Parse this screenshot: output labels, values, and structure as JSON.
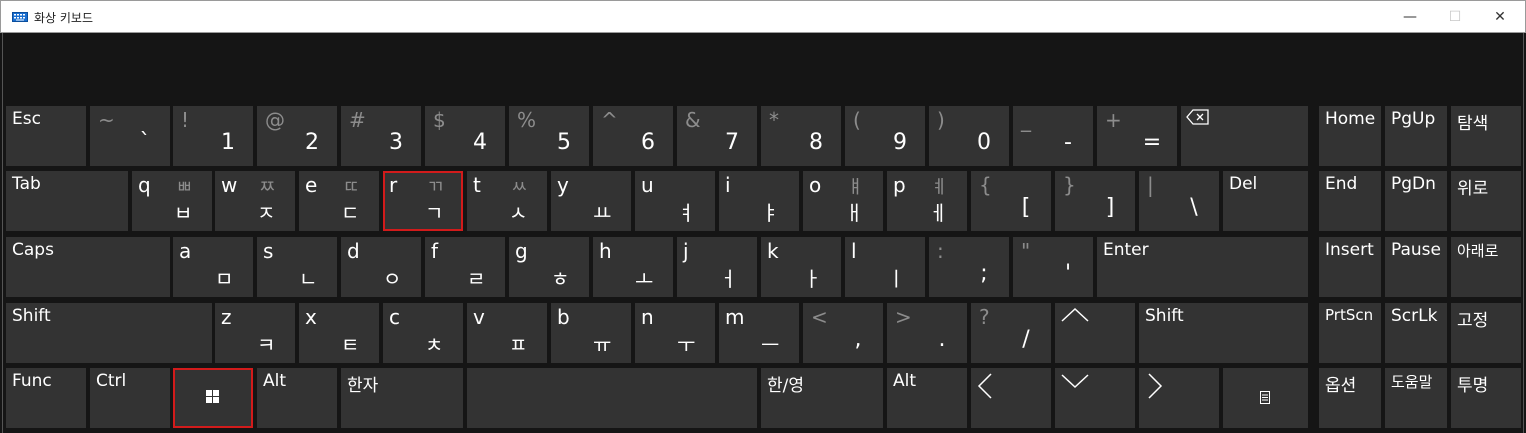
{
  "window": {
    "title": "화상 키보드",
    "minimize": "—",
    "maximize": "☐",
    "close": "✕"
  },
  "colors": {
    "key_bg": "#333333",
    "highlight": "#d21b1b",
    "panel_bg": "#151515",
    "muted_text": "#8c8c8c"
  },
  "row1": {
    "esc": "Esc",
    "k1": {
      "sh": "~",
      "base": "`"
    },
    "k2": {
      "sh": "!",
      "base": "1"
    },
    "k3": {
      "sh": "@",
      "base": "2"
    },
    "k4": {
      "sh": "#",
      "base": "3"
    },
    "k5": {
      "sh": "$",
      "base": "4"
    },
    "k6": {
      "sh": "%",
      "base": "5"
    },
    "k7": {
      "sh": "^",
      "base": "6"
    },
    "k8": {
      "sh": "&",
      "base": "7"
    },
    "k9": {
      "sh": "*",
      "base": "8"
    },
    "k10": {
      "sh": "(",
      "base": "9"
    },
    "k11": {
      "sh": ")",
      "base": "0"
    },
    "k12": {
      "sh": "_",
      "base": "-"
    },
    "k13": {
      "sh": "+",
      "base": "="
    },
    "backspace_icon": "backspace-icon"
  },
  "row2": {
    "tab": "Tab",
    "q": {
      "l": "q",
      "sh": "ㅃ",
      "h": "ㅂ"
    },
    "w": {
      "l": "w",
      "sh": "ㅉ",
      "h": "ㅈ"
    },
    "e": {
      "l": "e",
      "sh": "ㄸ",
      "h": "ㄷ"
    },
    "r": {
      "l": "r",
      "sh": "ㄲ",
      "h": "ㄱ"
    },
    "t": {
      "l": "t",
      "sh": "ㅆ",
      "h": "ㅅ"
    },
    "y": {
      "l": "y",
      "sh": "",
      "h": "ㅛ"
    },
    "u": {
      "l": "u",
      "sh": "",
      "h": "ㅕ"
    },
    "i": {
      "l": "i",
      "sh": "",
      "h": "ㅑ"
    },
    "o": {
      "l": "o",
      "sh": "ㅒ",
      "h": "ㅐ"
    },
    "p": {
      "l": "p",
      "sh": "ㅖ",
      "h": "ㅔ"
    },
    "lbracket": {
      "sh": "{",
      "base": "["
    },
    "rbracket": {
      "sh": "}",
      "base": "]"
    },
    "backslash": {
      "sh": "|",
      "base": "\\"
    },
    "del": "Del"
  },
  "row3": {
    "caps": "Caps",
    "a": {
      "l": "a",
      "h": "ㅁ"
    },
    "s": {
      "l": "s",
      "h": "ㄴ"
    },
    "d": {
      "l": "d",
      "h": "ㅇ"
    },
    "f": {
      "l": "f",
      "h": "ㄹ"
    },
    "g": {
      "l": "g",
      "h": "ㅎ"
    },
    "h": {
      "l": "h",
      "h": "ㅗ"
    },
    "j": {
      "l": "j",
      "h": "ㅓ"
    },
    "k": {
      "l": "k",
      "h": "ㅏ"
    },
    "lk": {
      "l": "l",
      "h": "ㅣ"
    },
    "semicolon": {
      "sh": ":",
      "base": ";"
    },
    "quote": {
      "sh": "\"",
      "base": "'"
    },
    "enter": "Enter"
  },
  "row4": {
    "shift_left": "Shift",
    "z": {
      "l": "z",
      "h": "ㅋ"
    },
    "x": {
      "l": "x",
      "h": "ㅌ"
    },
    "c": {
      "l": "c",
      "h": "ㅊ"
    },
    "v": {
      "l": "v",
      "h": "ㅍ"
    },
    "b": {
      "l": "b",
      "h": "ㅠ"
    },
    "n": {
      "l": "n",
      "h": "ㅜ"
    },
    "m": {
      "l": "m",
      "h": "ㅡ"
    },
    "comma": {
      "sh": "<",
      "base": ","
    },
    "period": {
      "sh": ">",
      "base": "."
    },
    "slash": {
      "sh": "?",
      "base": "/"
    },
    "up_icon": "chevron-up-icon",
    "shift_right": "Shift"
  },
  "row5": {
    "func": "Func",
    "ctrl": "Ctrl",
    "win_icon": "windows-logo-icon",
    "alt_left": "Alt",
    "hanja": "한자",
    "space": "",
    "hanyeong": "한/영",
    "alt_right": "Alt",
    "left_icon": "chevron-left-icon",
    "down_icon": "chevron-down-icon",
    "right_icon": "chevron-right-icon",
    "menu_icon": "context-menu-icon"
  },
  "nav": {
    "home": "Home",
    "pgup": "PgUp",
    "search": "탐색",
    "end": "End",
    "pgdn": "PgDn",
    "up": "위로",
    "insert": "Insert",
    "pause": "Pause",
    "down": "아래로",
    "prtscn": "PrtScn",
    "scrlk": "ScrLk",
    "pin": "고정",
    "options": "옵션",
    "help": "도움말",
    "fade": "투명"
  }
}
